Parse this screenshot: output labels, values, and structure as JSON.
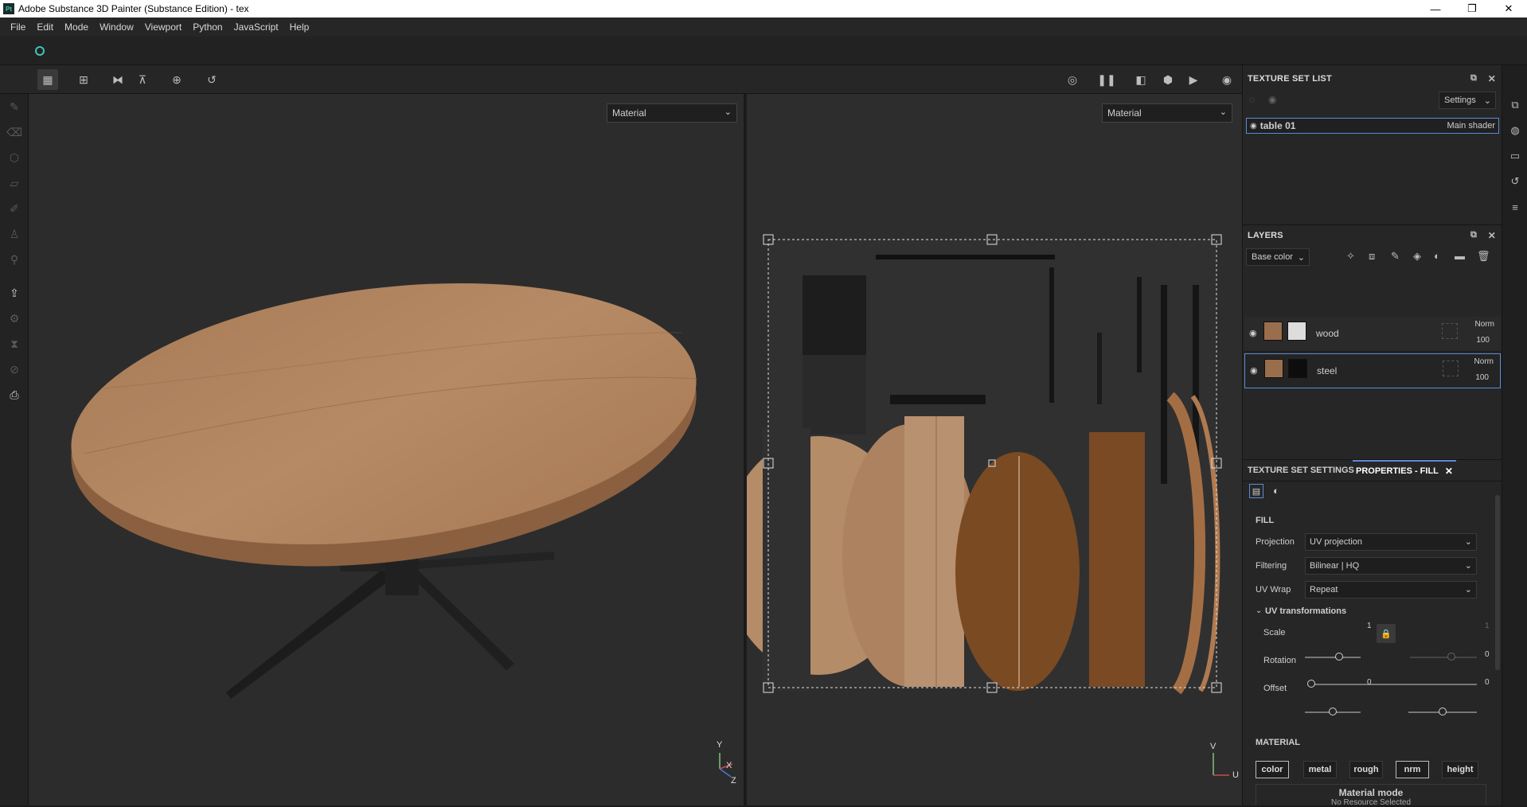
{
  "window": {
    "title": "Adobe Substance 3D Painter (Substance Edition) - tex",
    "app_badge": "Pt",
    "minimize": "—",
    "maximize": "❐",
    "close": "✕"
  },
  "menu": [
    "File",
    "Edit",
    "Mode",
    "Window",
    "Viewport",
    "Python",
    "JavaScript",
    "Help"
  ],
  "viewport3d": {
    "mode_select": "Material",
    "axis": {
      "y": "Y",
      "x": "X",
      "z": "Z"
    }
  },
  "viewport2d": {
    "mode_select": "Material",
    "axis": {
      "v": "V",
      "u": "U"
    }
  },
  "texture_set_list": {
    "title": "TEXTURE SET LIST",
    "settings_label": "Settings",
    "item_name": "table 01",
    "item_shader": "Main shader"
  },
  "layers": {
    "title": "LAYERS",
    "channel_select": "Base color",
    "items": [
      {
        "name": "wood",
        "blend": "Norm",
        "opacity": "100"
      },
      {
        "name": "steel",
        "blend": "Norm",
        "opacity": "100"
      }
    ]
  },
  "tabs": {
    "texture_set_settings": "TEXTURE SET SETTINGS",
    "properties_fill": "PROPERTIES - FILL"
  },
  "fill": {
    "section": "FILL",
    "projection_label": "Projection",
    "projection_value": "UV projection",
    "filtering_label": "Filtering",
    "filtering_value": "Bilinear | HQ",
    "uvwrap_label": "UV Wrap",
    "uvwrap_value": "Repeat",
    "uv_transformations": "UV transformations",
    "scale_label": "Scale",
    "scale_value": "1",
    "scale_value2": "1",
    "rotation_label": "Rotation",
    "rotation_value": "0",
    "offset_label": "Offset",
    "offset_u": "0",
    "offset_v": "0",
    "levels": {
      "scale": 0.62,
      "scale2": 0.62,
      "rotation": 0.0,
      "offset_u": 0.5,
      "offset_v": 0.5
    }
  },
  "material": {
    "section": "MATERIAL",
    "buttons": [
      {
        "label": "color",
        "on": true
      },
      {
        "label": "metal",
        "on": false
      },
      {
        "label": "rough",
        "on": false
      },
      {
        "label": "nrm",
        "on": true
      },
      {
        "label": "height",
        "on": false
      }
    ],
    "mode_title": "Material mode",
    "mode_sub": "No Resource Selected"
  },
  "colors": {
    "accent": "#5b8ad8",
    "teal": "#3ec6b4",
    "wood": "#b48259"
  }
}
